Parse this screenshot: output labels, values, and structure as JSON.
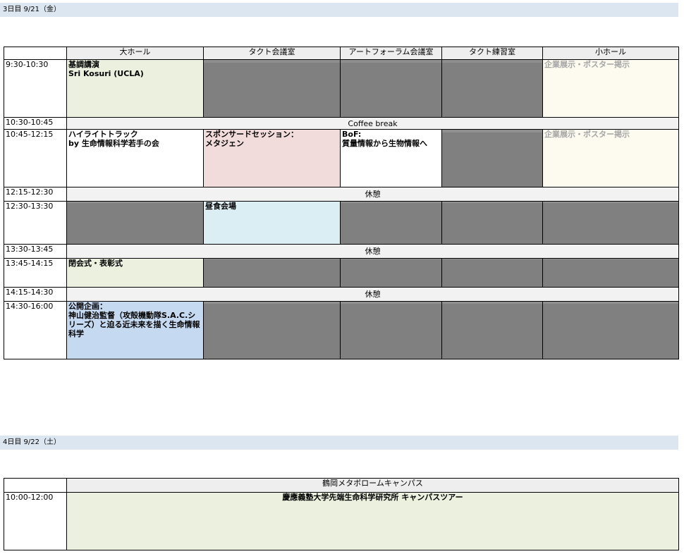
{
  "day3": {
    "header": "3日目 9/21（金）",
    "rooms": [
      "大ホール",
      "タクト会議室",
      "アートフォーラム会議室",
      "タクト練習室",
      "小ホール"
    ],
    "rows": [
      {
        "time": "9:30-10:30",
        "big_hall": "基調講演\nSri Kosuri (UCLA)",
        "small_hall": "企業展示・ポスター掲示"
      },
      {
        "time": "10:30-10:45",
        "span": "Coffee break"
      },
      {
        "time": "10:45-12:15",
        "big_hall": "ハイライトトラック\nby 生命情報科学若手の会",
        "takt_conf": "スポンサードセッション：\nメタジェン",
        "art_forum": "BoF:\n質量情報から生物情報へ",
        "small_hall": "企業展示・ポスター掲示"
      },
      {
        "time": "12:15-12:30",
        "span": "休憩"
      },
      {
        "time": "12:30-13:30",
        "takt_conf": "昼食会場"
      },
      {
        "time": "13:30-13:45",
        "span": "休憩"
      },
      {
        "time": "13:45-14:15",
        "big_hall": "閉会式・表彰式"
      },
      {
        "time": "14:15-14:30",
        "span": "休憩"
      },
      {
        "time": "14:30-16:00",
        "big_hall": "公開企画：\n神山健治監督（攻殻機動隊S.A.C.シリーズ）と迫る近未来を描く生命情報科学"
      }
    ]
  },
  "day4": {
    "header": "4日目 9/22（土）",
    "venue": "鶴岡メタボロームキャンパス",
    "rows": [
      {
        "time": "10:00-12:00",
        "event": "慶應義塾大学先端生命科学研究所 キャンパスツアー"
      }
    ]
  }
}
